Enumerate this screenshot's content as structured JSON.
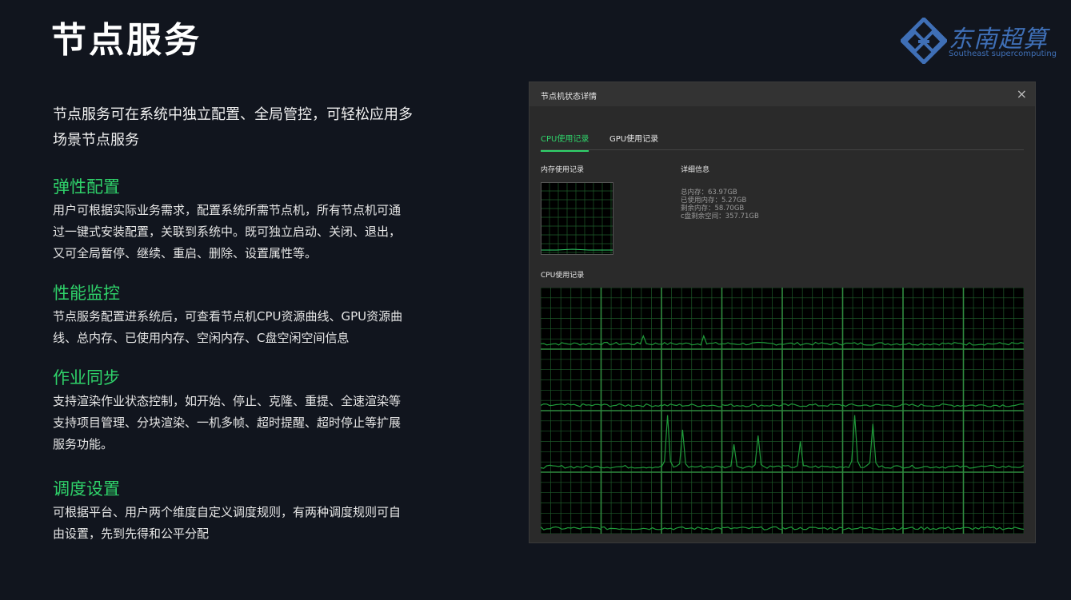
{
  "page": {
    "title": "节点服务",
    "logo": {
      "text": "东南超算",
      "subtitle": "Southeast supercomputing",
      "color": "#3f6fb6"
    },
    "intro": [
      "节点服务可在系统中独立配置、全局管控，可轻松应用多",
      "场景节点服务"
    ],
    "accent": "#2fd26a",
    "features": [
      {
        "title": "弹性配置",
        "lines": [
          "用户可根据实际业务需求，配置系统所需节点机，所有节点机可通",
          "过一键式安装配置，关联到系统中。既可独立启动、关闭、退出，",
          "又可全局暂停、继续、重启、删除、设置属性等。"
        ]
      },
      {
        "title": "性能监控",
        "lines": [
          "节点服务配置进系统后，可查看节点机CPU资源曲线、GPU资源曲",
          "线、总内存、已使用内存、空闲内存、C盘空闲空间信息"
        ]
      },
      {
        "title": "作业同步",
        "lines": [
          "支持渲染作业状态控制，如开始、停止、克隆、重提、全速渲染等",
          "支持项目管理、分块渲染、一机多帧、超时提醒、超时停止等扩展",
          "服务功能。"
        ]
      },
      {
        "title": "调度设置",
        "lines": [
          "可根据平台、用户两个维度自定义调度规则，有两种调度规则可自",
          "由设置，先到先得和公平分配"
        ]
      }
    ]
  },
  "window": {
    "title": "节点机状态详情",
    "close_icon": "×",
    "tabs": [
      {
        "label": "CPU使用记录",
        "active": true
      },
      {
        "label": "GPU使用记录",
        "active": false
      }
    ],
    "memory_label": "内存使用记录",
    "details_label": "详细信息",
    "details": [
      "总内存：63.97GB",
      "已使用内存：5.27GB",
      "剩余内存：58.70GB",
      "c盘剩余空间：357.71GB"
    ],
    "cpu_label": "CPU使用记录",
    "graph_color": "#1f9a3a",
    "grid_color": "#1e5a2a"
  }
}
